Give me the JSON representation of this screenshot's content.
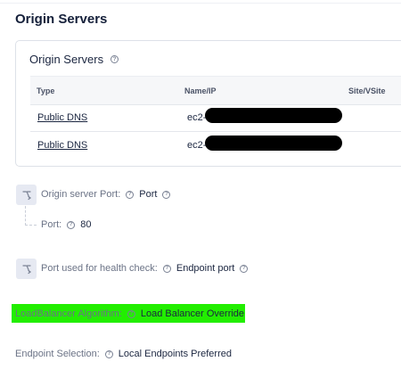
{
  "page": {
    "title": "Origin Servers"
  },
  "origin_servers": {
    "card_title": "Origin Servers",
    "columns": [
      "Type",
      "Name/IP",
      "Site/VSite"
    ],
    "rows": [
      {
        "type": "Public DNS",
        "name_prefix": "ec2-",
        "site": ""
      },
      {
        "type": "Public DNS",
        "name_prefix": "ec2-",
        "site": ""
      }
    ]
  },
  "fields": {
    "origin_port": {
      "label": "Origin server Port:",
      "value": "Port"
    },
    "port": {
      "label": "Port:",
      "value": "80"
    },
    "health_check": {
      "label": "Port used for health check:",
      "value": "Endpoint port"
    },
    "lb_algorithm": {
      "label": "LoadBalancer Algorithm:",
      "value": "Load Balancer Override"
    },
    "endpoint_selection": {
      "label": "Endpoint Selection:",
      "value": "Local Endpoints Preferred"
    }
  },
  "colors": {
    "highlight": "#22ee00",
    "icon_bg": "#e6e9f2",
    "text": "#1b2640"
  },
  "icons": {
    "field": "branch-icon",
    "help": "help-circle-icon"
  }
}
